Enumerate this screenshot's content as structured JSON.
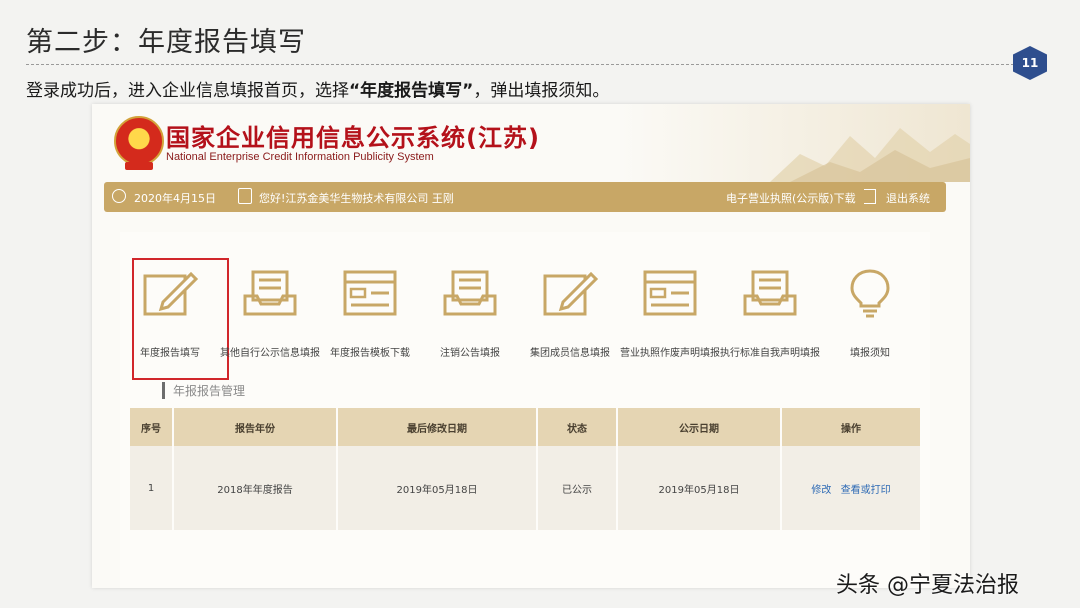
{
  "slide": {
    "title": "第二步：年度报告填写",
    "page_number": "11",
    "intro_prefix": "登录成功后，进入企业信息填报首页，选择",
    "intro_highlight": "“年度报告填写”",
    "intro_suffix": "，弹出填报须知。"
  },
  "site": {
    "name": "国家企业信用信息公示系统(江苏)",
    "subtitle": "National Enterprise Credit Information Publicity System"
  },
  "user_bar": {
    "date": "2020年4月15日",
    "greeting": "您好!江苏金美华生物技术有限公司    王刚",
    "license_download": "电子营业执照(公示版)下载",
    "logout": "退出系统"
  },
  "functions": [
    {
      "label": "年度报告填写",
      "icon": "edit-icon",
      "selected": true
    },
    {
      "label": "其他自行公示信息填报",
      "icon": "inbox-icon",
      "selected": false
    },
    {
      "label": "年度报告模板下载",
      "icon": "form-icon",
      "selected": false
    },
    {
      "label": "注销公告填报",
      "icon": "inbox-icon",
      "selected": false
    },
    {
      "label": "集团成员信息填报",
      "icon": "edit-icon",
      "selected": false
    },
    {
      "label": "营业执照作废声明填报",
      "icon": "form-icon",
      "selected": false
    },
    {
      "label": "执行标准自我声明填报",
      "icon": "inbox-icon",
      "selected": false
    },
    {
      "label": "填报须知",
      "icon": "lightbulb-icon",
      "selected": false
    }
  ],
  "section_label": "年报报告管理",
  "table": {
    "headers": [
      "序号",
      "报告年份",
      "最后修改日期",
      "状态",
      "公示日期",
      "操作"
    ],
    "rows": [
      {
        "index": "1",
        "year": "2018年年度报告",
        "modified": "2019年05月18日",
        "status": "已公示",
        "published": "2019年05月18日",
        "actions": [
          "修改",
          "查看或打印"
        ]
      }
    ]
  },
  "watermark": "头条 @宁夏法治报",
  "colors": {
    "gold": "#c8a766",
    "brand_red": "#b4111a",
    "badge_blue": "#2e4e8e",
    "selection_red": "#d1262b",
    "link_blue": "#2f6bb5"
  }
}
